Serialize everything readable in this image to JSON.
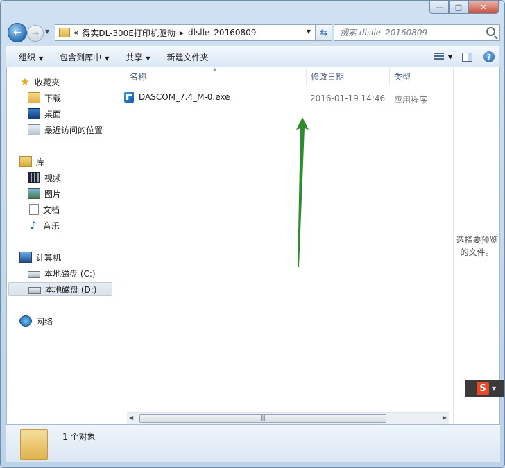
{
  "address": {
    "overflow": "«",
    "crumbs": [
      "得实DL-300E打印机驱动",
      "dlslle_20160809"
    ]
  },
  "search": {
    "placeholder": "搜索 dlslle_20160809"
  },
  "toolbar": {
    "organize": "组织",
    "include_library": "包含到库中",
    "share": "共享",
    "new_folder": "新建文件夹"
  },
  "sidebar": {
    "favorites": "收藏夹",
    "downloads": "下载",
    "desktop": "桌面",
    "recent": "最近访问的位置",
    "libraries": "库",
    "videos": "视频",
    "pictures": "图片",
    "documents": "文档",
    "music": "音乐",
    "computer": "计算机",
    "drive_c": "本地磁盘 (C:)",
    "drive_d": "本地磁盘 (D:)",
    "network": "网络"
  },
  "columns": {
    "name": "名称",
    "date": "修改日期",
    "type": "类型"
  },
  "files": [
    {
      "name": "DASCOM_7.4_M-0.exe",
      "date": "2016-01-19 14:46",
      "type": "应用程序"
    }
  ],
  "preview": {
    "text": "选择要预览的文件。"
  },
  "status": {
    "count": "1 个对象"
  },
  "ime": {
    "label": "S"
  },
  "colors": {
    "arrow": "#2e8b2e",
    "selection": "#d9e2ea"
  }
}
